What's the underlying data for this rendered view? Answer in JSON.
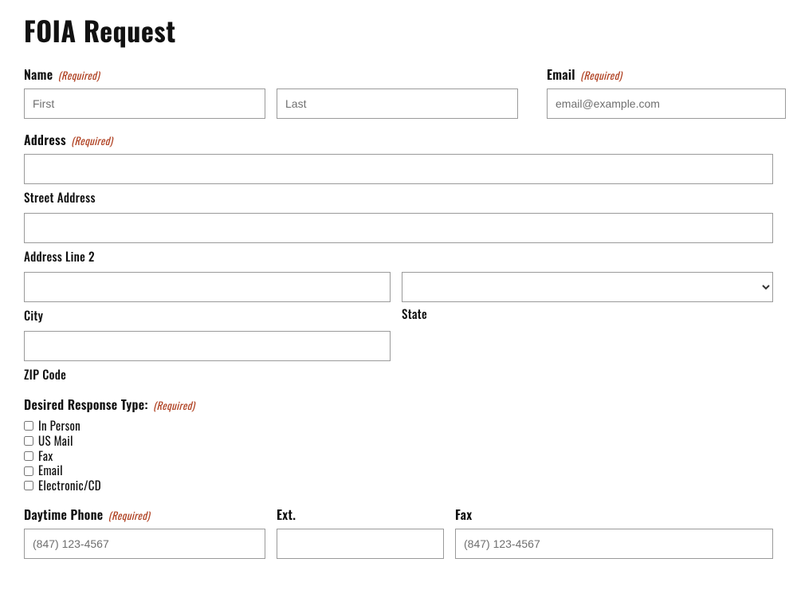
{
  "title": "FOIA Request",
  "required_text": "(Required)",
  "name": {
    "label": "Name",
    "first_placeholder": "First",
    "last_placeholder": "Last"
  },
  "email": {
    "label": "Email",
    "placeholder": "email@example.com"
  },
  "address": {
    "label": "Address",
    "street_sublabel": "Street Address",
    "line2_sublabel": "Address Line 2",
    "city_sublabel": "City",
    "state_sublabel": "State",
    "zip_sublabel": "ZIP Code"
  },
  "response_type": {
    "label": "Desired Response Type:",
    "options": [
      "In Person",
      "US Mail",
      "Fax",
      "Email",
      "Electronic/CD"
    ]
  },
  "daytime_phone": {
    "label": "Daytime Phone",
    "placeholder": "(847) 123-4567"
  },
  "ext": {
    "label": "Ext."
  },
  "fax": {
    "label": "Fax",
    "placeholder": "(847) 123-4567"
  }
}
